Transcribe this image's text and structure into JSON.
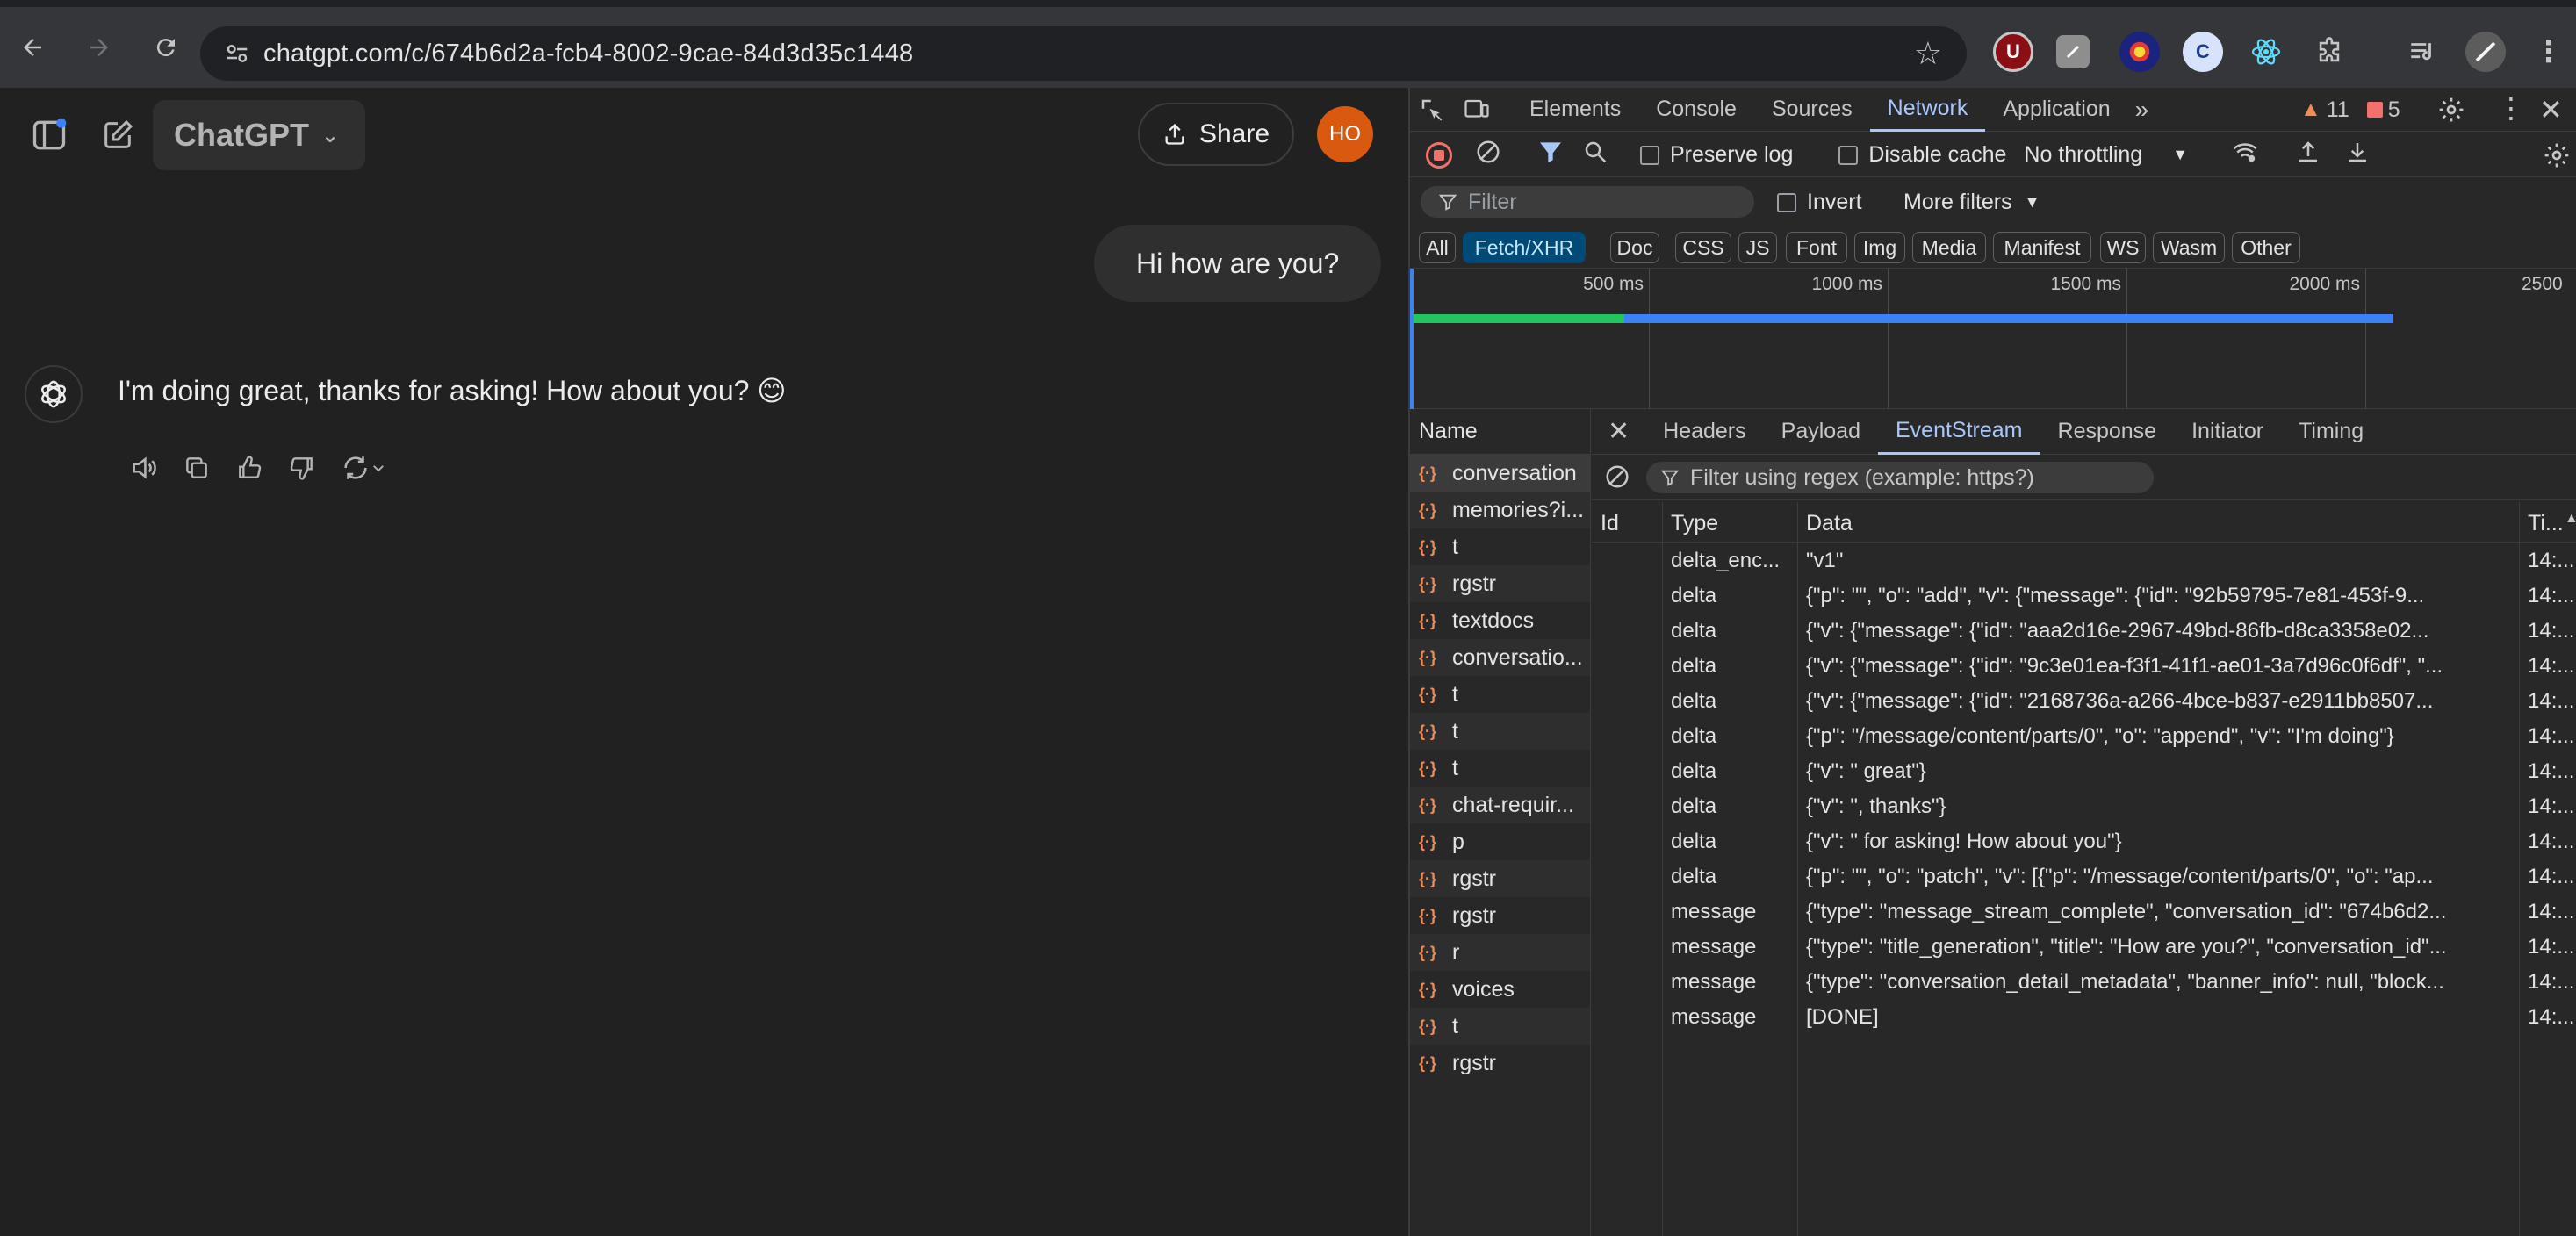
{
  "browser": {
    "url": "chatgpt.com/c/674b6d2a-fcb4-8002-9cae-84d3d35c1448",
    "ext_u": "U",
    "ext_c": "C"
  },
  "chat": {
    "model": "ChatGPT",
    "share": "Share",
    "avatar": "HO",
    "user_message": "Hi how are you?",
    "assistant_message": "I'm doing great, thanks for asking! How about you? 😊"
  },
  "devtools": {
    "tabs": [
      "Elements",
      "Console",
      "Sources",
      "Network",
      "Application"
    ],
    "warnings": "11",
    "errors": "5",
    "preserve_log": "Preserve log",
    "disable_cache": "Disable cache",
    "throttling": "No throttling",
    "filter_placeholder": "Filter",
    "invert": "Invert",
    "more_filters": "More filters",
    "types": [
      "All",
      "Fetch/XHR",
      "Doc",
      "CSS",
      "JS",
      "Font",
      "Img",
      "Media",
      "Manifest",
      "WS",
      "Wasm",
      "Other"
    ],
    "timeline": [
      "500 ms",
      "1000 ms",
      "1500 ms",
      "2000 ms",
      "2500"
    ],
    "name_header": "Name",
    "requests": [
      "conversation",
      "memories?i...",
      "t",
      "rgstr",
      "textdocs",
      "conversatio...",
      "t",
      "t",
      "t",
      "chat-requir...",
      "p",
      "rgstr",
      "rgstr",
      "r",
      "voices",
      "t",
      "rgstr"
    ],
    "detail_tabs": [
      "Headers",
      "Payload",
      "EventStream",
      "Response",
      "Initiator",
      "Timing"
    ],
    "regex_placeholder": "Filter using regex (example: https?)",
    "columns": {
      "id": "Id",
      "type": "Type",
      "data": "Data",
      "time": "Ti..."
    },
    "events": [
      {
        "id": "",
        "type": "delta_enc...",
        "data": "\"v1\"",
        "time": "14:..."
      },
      {
        "id": "",
        "type": "delta",
        "data": "{\"p\": \"\", \"o\": \"add\", \"v\": {\"message\": {\"id\": \"92b59795-7e81-453f-9...",
        "time": "14:..."
      },
      {
        "id": "",
        "type": "delta",
        "data": "{\"v\": {\"message\": {\"id\": \"aaa2d16e-2967-49bd-86fb-d8ca3358e02...",
        "time": "14:..."
      },
      {
        "id": "",
        "type": "delta",
        "data": "{\"v\": {\"message\": {\"id\": \"9c3e01ea-f3f1-41f1-ae01-3a7d96c0f6df\", \"...",
        "time": "14:..."
      },
      {
        "id": "",
        "type": "delta",
        "data": "{\"v\": {\"message\": {\"id\": \"2168736a-a266-4bce-b837-e2911bb8507...",
        "time": "14:..."
      },
      {
        "id": "",
        "type": "delta",
        "data": "{\"p\": \"/message/content/parts/0\", \"o\": \"append\", \"v\": \"I'm doing\"}",
        "time": "14:..."
      },
      {
        "id": "",
        "type": "delta",
        "data": "{\"v\": \" great\"}",
        "time": "14:..."
      },
      {
        "id": "",
        "type": "delta",
        "data": "{\"v\": \", thanks\"}",
        "time": "14:..."
      },
      {
        "id": "",
        "type": "delta",
        "data": "{\"v\": \" for asking! How about you\"}",
        "time": "14:..."
      },
      {
        "id": "",
        "type": "delta",
        "data": "{\"p\": \"\", \"o\": \"patch\", \"v\": [{\"p\": \"/message/content/parts/0\", \"o\": \"ap...",
        "time": "14:..."
      },
      {
        "id": "",
        "type": "message",
        "data": "{\"type\": \"message_stream_complete\", \"conversation_id\": \"674b6d2...",
        "time": "14:..."
      },
      {
        "id": "",
        "type": "message",
        "data": "{\"type\": \"title_generation\", \"title\": \"How are you?\", \"conversation_id\"...",
        "time": "14:..."
      },
      {
        "id": "",
        "type": "message",
        "data": "{\"type\": \"conversation_detail_metadata\", \"banner_info\": null, \"block...",
        "time": "14:..."
      },
      {
        "id": "",
        "type": "message",
        "data": "[DONE]",
        "time": "14:..."
      }
    ]
  },
  "colors": {
    "accent": "#a8c7fa",
    "avatar": "#d9590f",
    "request_icon": "#f28b54"
  }
}
